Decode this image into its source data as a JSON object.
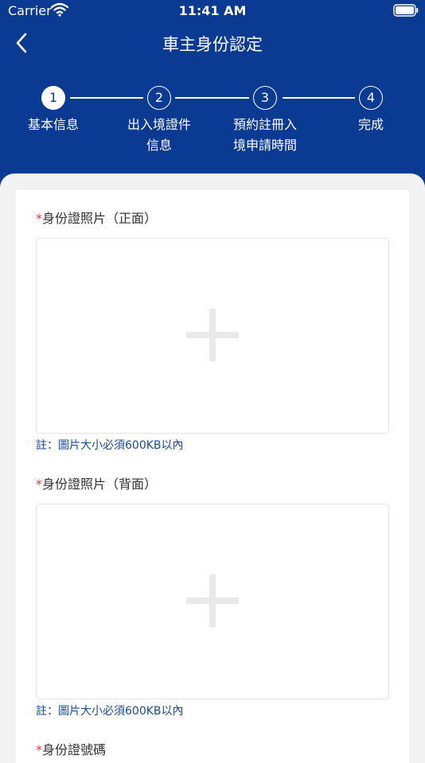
{
  "status_bar": {
    "carrier": "Carrier",
    "time": "11:41 AM"
  },
  "nav": {
    "title": "車主身份認定",
    "back_icon": "chevron-left-icon"
  },
  "colors": {
    "header_bg": "#0a3a92",
    "required": "#e53935",
    "note": "#1a4a9a"
  },
  "steps": [
    {
      "number": "1",
      "line1": "基本信息",
      "line2": "",
      "active": true
    },
    {
      "number": "2",
      "line1": "出入境證件",
      "line2": "信息",
      "active": false
    },
    {
      "number": "3",
      "line1": "預約註冊入",
      "line2": "境申請時間",
      "active": false
    },
    {
      "number": "4",
      "line1": "完成",
      "line2": "",
      "active": false
    }
  ],
  "form": {
    "required_mark": "*",
    "front_photo_label": "身份證照片（正面）",
    "back_photo_label": "身份證照片（背面）",
    "note": "註：圖片大小必須600KB以內",
    "id_number_label": "身份證號碼"
  }
}
